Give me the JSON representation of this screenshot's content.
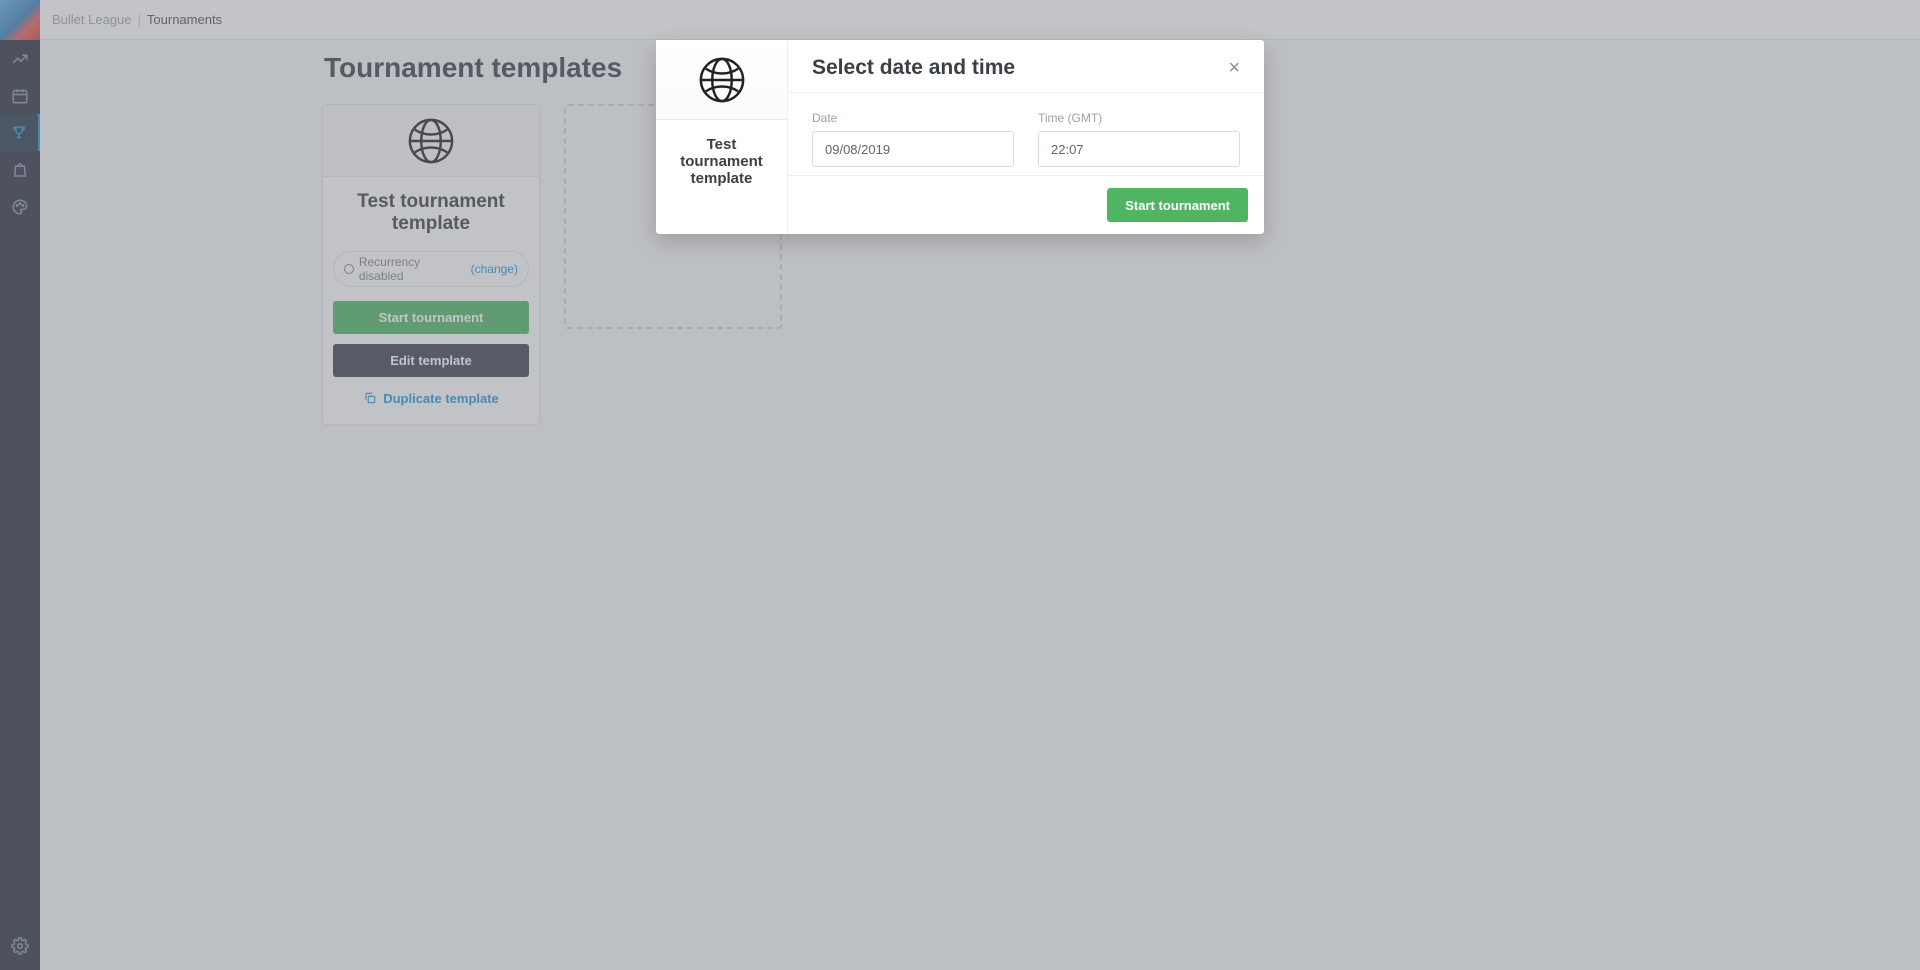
{
  "breadcrumb": {
    "parent": "Bullet League",
    "separator": "|",
    "current": "Tournaments"
  },
  "page": {
    "title": "Tournament templates"
  },
  "card": {
    "title": "Test tournament template",
    "recurrency_text": "Recurrency disabled",
    "recurrency_change": "(change)",
    "start_btn": "Start tournament",
    "edit_btn": "Edit template",
    "duplicate": "Duplicate template"
  },
  "modal": {
    "left_title": "Test tournament template",
    "title": "Select date and time",
    "date_label": "Date",
    "time_label": "Time (GMT)",
    "date_value": "09/08/2019",
    "time_value": "22:07",
    "submit": "Start tournament"
  }
}
